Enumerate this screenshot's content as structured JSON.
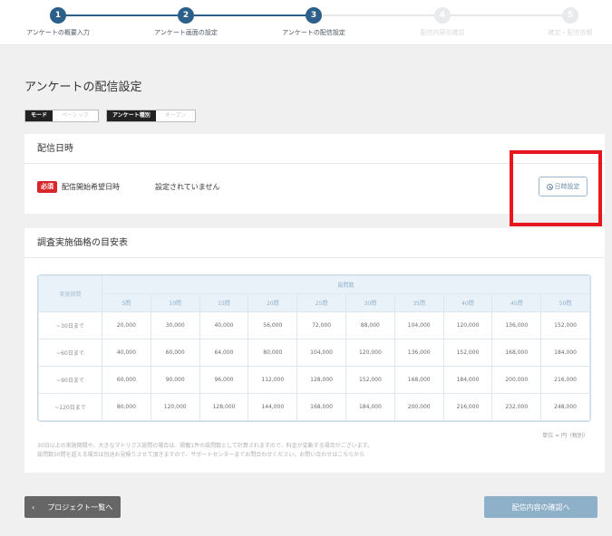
{
  "stepper": {
    "steps": [
      {
        "num": "1",
        "label": "アンケートの概要入力",
        "state": "done"
      },
      {
        "num": "2",
        "label": "アンケート画面の設定",
        "state": "done"
      },
      {
        "num": "3",
        "label": "アンケートの配信設定",
        "state": "current"
      },
      {
        "num": "4",
        "label": "配信内容の確認",
        "state": "inactive"
      },
      {
        "num": "5",
        "label": "確定・配信依頼",
        "state": "inactive"
      }
    ]
  },
  "page_title": "アンケートの配信設定",
  "badges": [
    {
      "key": "モード",
      "value": "ベーシック"
    },
    {
      "key": "アンケート種別",
      "value": "オープン"
    }
  ],
  "delivery_card": {
    "title": "配信日時",
    "required": "必須",
    "field_label": "配信開始希望日時",
    "field_value": "設定されていません",
    "datetime_button": "日時設定"
  },
  "price_card": {
    "title": "調査実施価格の目安表",
    "corner_header": "実施期間",
    "questions_header": "設問数",
    "question_counts": [
      "5問",
      "10問",
      "15問",
      "20問",
      "25問",
      "30問",
      "35問",
      "40問",
      "45問",
      "50問"
    ],
    "rows": [
      {
        "label": "~30日まで",
        "values": [
          "20,000",
          "30,000",
          "40,000",
          "56,000",
          "72,000",
          "88,000",
          "104,000",
          "120,000",
          "136,000",
          "152,000"
        ]
      },
      {
        "label": "~60日まで",
        "values": [
          "40,000",
          "60,000",
          "64,000",
          "80,000",
          "104,000",
          "120,000",
          "136,000",
          "152,000",
          "168,000",
          "184,000"
        ]
      },
      {
        "label": "~90日まで",
        "values": [
          "60,000",
          "90,000",
          "96,000",
          "112,000",
          "128,000",
          "152,000",
          "168,000",
          "184,000",
          "200,000",
          "216,000"
        ]
      },
      {
        "label": "~120日まで",
        "values": [
          "80,000",
          "120,000",
          "128,000",
          "144,000",
          "168,000",
          "184,000",
          "200,000",
          "216,000",
          "232,000",
          "248,000"
        ]
      }
    ],
    "unit_note": "単位 = 円（税別）",
    "note_line1": "30日以上の実施期間や、大きなマトリクス設問の場合は、掲載1件の設問数として計算されますので、料金が変動する場合がございます。",
    "note_line2": "設問数50問を超える場合は別途お見積りさせて頂きますので、サポートセンターまでお問合わせください。お問い合わせはこちらから"
  },
  "footer": {
    "back_arrow": "‹",
    "back_label": "プロジェクト一覧へ",
    "next_label": "配信内容の確認へ"
  }
}
